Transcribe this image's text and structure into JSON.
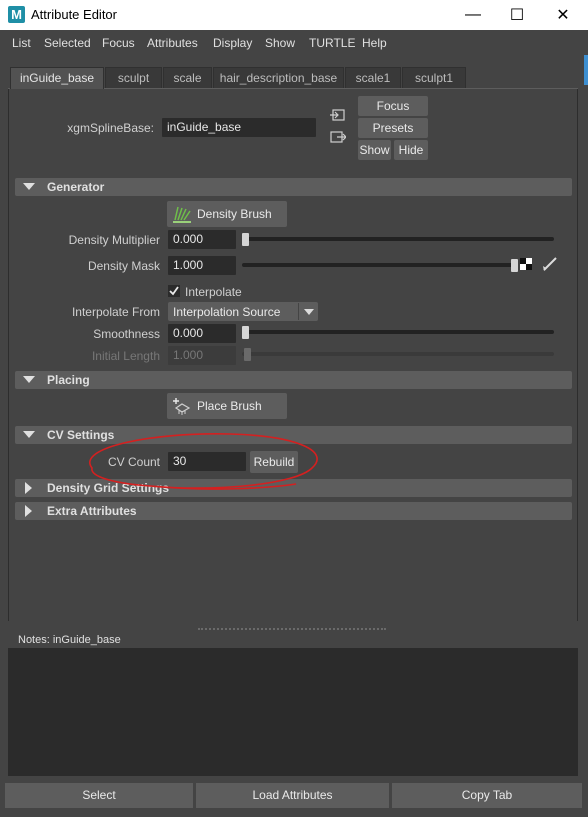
{
  "window": {
    "title": "Attribute Editor",
    "app_icon_letter": "M",
    "minimize_glyph": "—",
    "maximize_glyph": "☐",
    "close_glyph": "✕"
  },
  "menu": [
    "List",
    "Selected",
    "Focus",
    "Attributes",
    "Display",
    "Show",
    "TURTLE",
    "Help"
  ],
  "tabs": [
    "inGuide_base",
    "sculpt",
    "scale",
    "hair_description_base",
    "scale1",
    "sculpt1"
  ],
  "node": {
    "type_label": "xgmSplineBase:",
    "name_value": "inGuide_base",
    "focus_label": "Focus",
    "presets_label": "Presets",
    "show_label": "Show",
    "hide_label": "Hide"
  },
  "generator": {
    "title": "Generator",
    "density_brush_label": "Density Brush",
    "density_multiplier_label": "Density Multiplier",
    "density_multiplier_value": "0.000",
    "density_multiplier_slider": 0.0,
    "density_mask_label": "Density Mask",
    "density_mask_value": "1.000",
    "density_mask_slider": 1.0,
    "interpolate_label": "Interpolate",
    "interpolate_checked": true,
    "interpolate_from_label": "Interpolate From",
    "interpolate_from_value": "Interpolation Source",
    "smoothness_label": "Smoothness",
    "smoothness_value": "0.000",
    "smoothness_slider": 0.0,
    "initial_length_label": "Initial Length",
    "initial_length_value": "1.000",
    "initial_length_slider": 0.0
  },
  "placing": {
    "title": "Placing",
    "place_brush_label": "Place Brush"
  },
  "cv_settings": {
    "title": "CV Settings",
    "cv_count_label": "CV Count",
    "cv_count_value": "30",
    "rebuild_label": "Rebuild"
  },
  "density_grid": {
    "title": "Density Grid Settings"
  },
  "extra": {
    "title": "Extra Attributes"
  },
  "notes": {
    "label": "Notes:  inGuide_base"
  },
  "bottom": {
    "select_label": "Select",
    "load_label": "Load Attributes",
    "copy_label": "Copy Tab"
  },
  "colors": {
    "background": "#444444",
    "field": "#2b2b2b",
    "section_header": "#5d5d5d",
    "annotation_circle": "#d42020"
  }
}
